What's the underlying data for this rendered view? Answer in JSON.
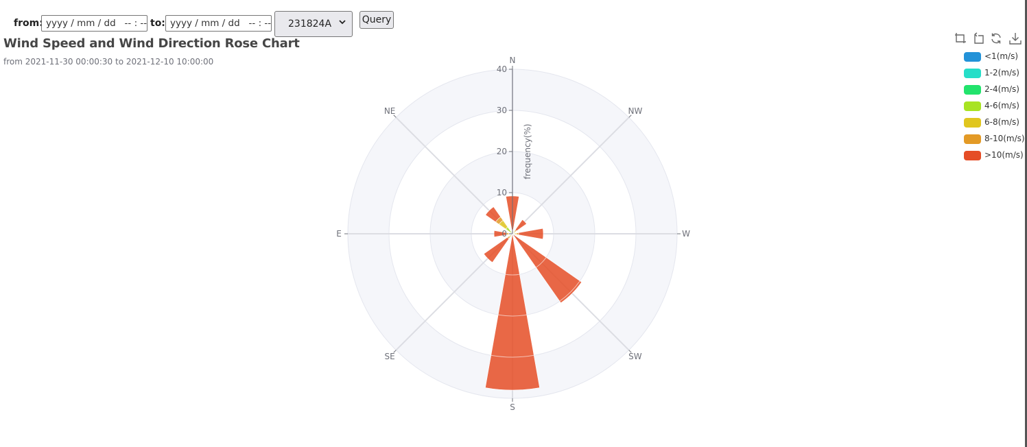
{
  "controls": {
    "from_label": "from:",
    "from_value": "yyyy / mm / dd   -- : --",
    "to_label": "to:",
    "to_value": "yyyy / mm / dd   -- : --",
    "station_selected": "231824A",
    "query_label": "Query"
  },
  "toolbox": {
    "icons": [
      "zoom-select-icon",
      "zoom-reset-icon",
      "restore-icon",
      "save-image-icon"
    ]
  },
  "chart_data": {
    "type": "bar",
    "polar": true,
    "title": "Wind Speed and Wind Direction Rose Chart",
    "subtitle": "from 2021-11-30 00:00:30 to 2021-12-10 10:00:00",
    "radius_label": "frequency(%)",
    "radius_range": [
      0,
      40
    ],
    "radius_ticks": [
      "0",
      "10",
      "20",
      "30",
      "40"
    ],
    "directions": [
      "N",
      "NW",
      "W",
      "SW",
      "S",
      "SE",
      "E",
      "NE"
    ],
    "direction_angles_deg": [
      0,
      45,
      90,
      135,
      180,
      225,
      270,
      315
    ],
    "stacked": true,
    "bars": [
      {
        "angle": 0,
        "values": [
          0,
          0,
          0,
          0.3,
          0.3,
          0.4,
          8.2
        ]
      },
      {
        "angle": 45,
        "values": [
          0,
          0,
          0,
          0.4,
          0.4,
          0.4,
          3.0
        ]
      },
      {
        "angle": 90,
        "values": [
          0,
          0,
          0,
          0.5,
          0.5,
          0.5,
          6.0
        ]
      },
      {
        "angle": 135,
        "values": [
          0,
          0,
          0,
          0,
          0,
          0.3,
          20.2
        ]
      },
      {
        "angle": 180,
        "values": [
          0,
          0,
          0,
          0,
          0,
          0,
          38.0
        ]
      },
      {
        "angle": 225,
        "values": [
          0,
          0,
          0,
          0.5,
          0.5,
          0.5,
          7.0
        ]
      },
      {
        "angle": 270,
        "values": [
          0,
          0,
          0,
          0.5,
          0.5,
          0.5,
          3.0
        ]
      },
      {
        "angle": 315,
        "values": [
          0,
          0,
          0,
          2.0,
          2.0,
          1.0,
          3.0
        ]
      }
    ],
    "series": [
      {
        "name": "<1(m/s)",
        "color": "#2392d8"
      },
      {
        "name": "1-2(m/s)",
        "color": "#26dec8"
      },
      {
        "name": "2-4(m/s)",
        "color": "#22e36c"
      },
      {
        "name": "4-6(m/s)",
        "color": "#a8e322"
      },
      {
        "name": "6-8(m/s)",
        "color": "#e0c61e"
      },
      {
        "name": "8-10(m/s)",
        "color": "#e39a26"
      },
      {
        "name": ">10(m/s)",
        "color": "#e54d26"
      }
    ],
    "legend_position": "top-right",
    "grid": true
  }
}
